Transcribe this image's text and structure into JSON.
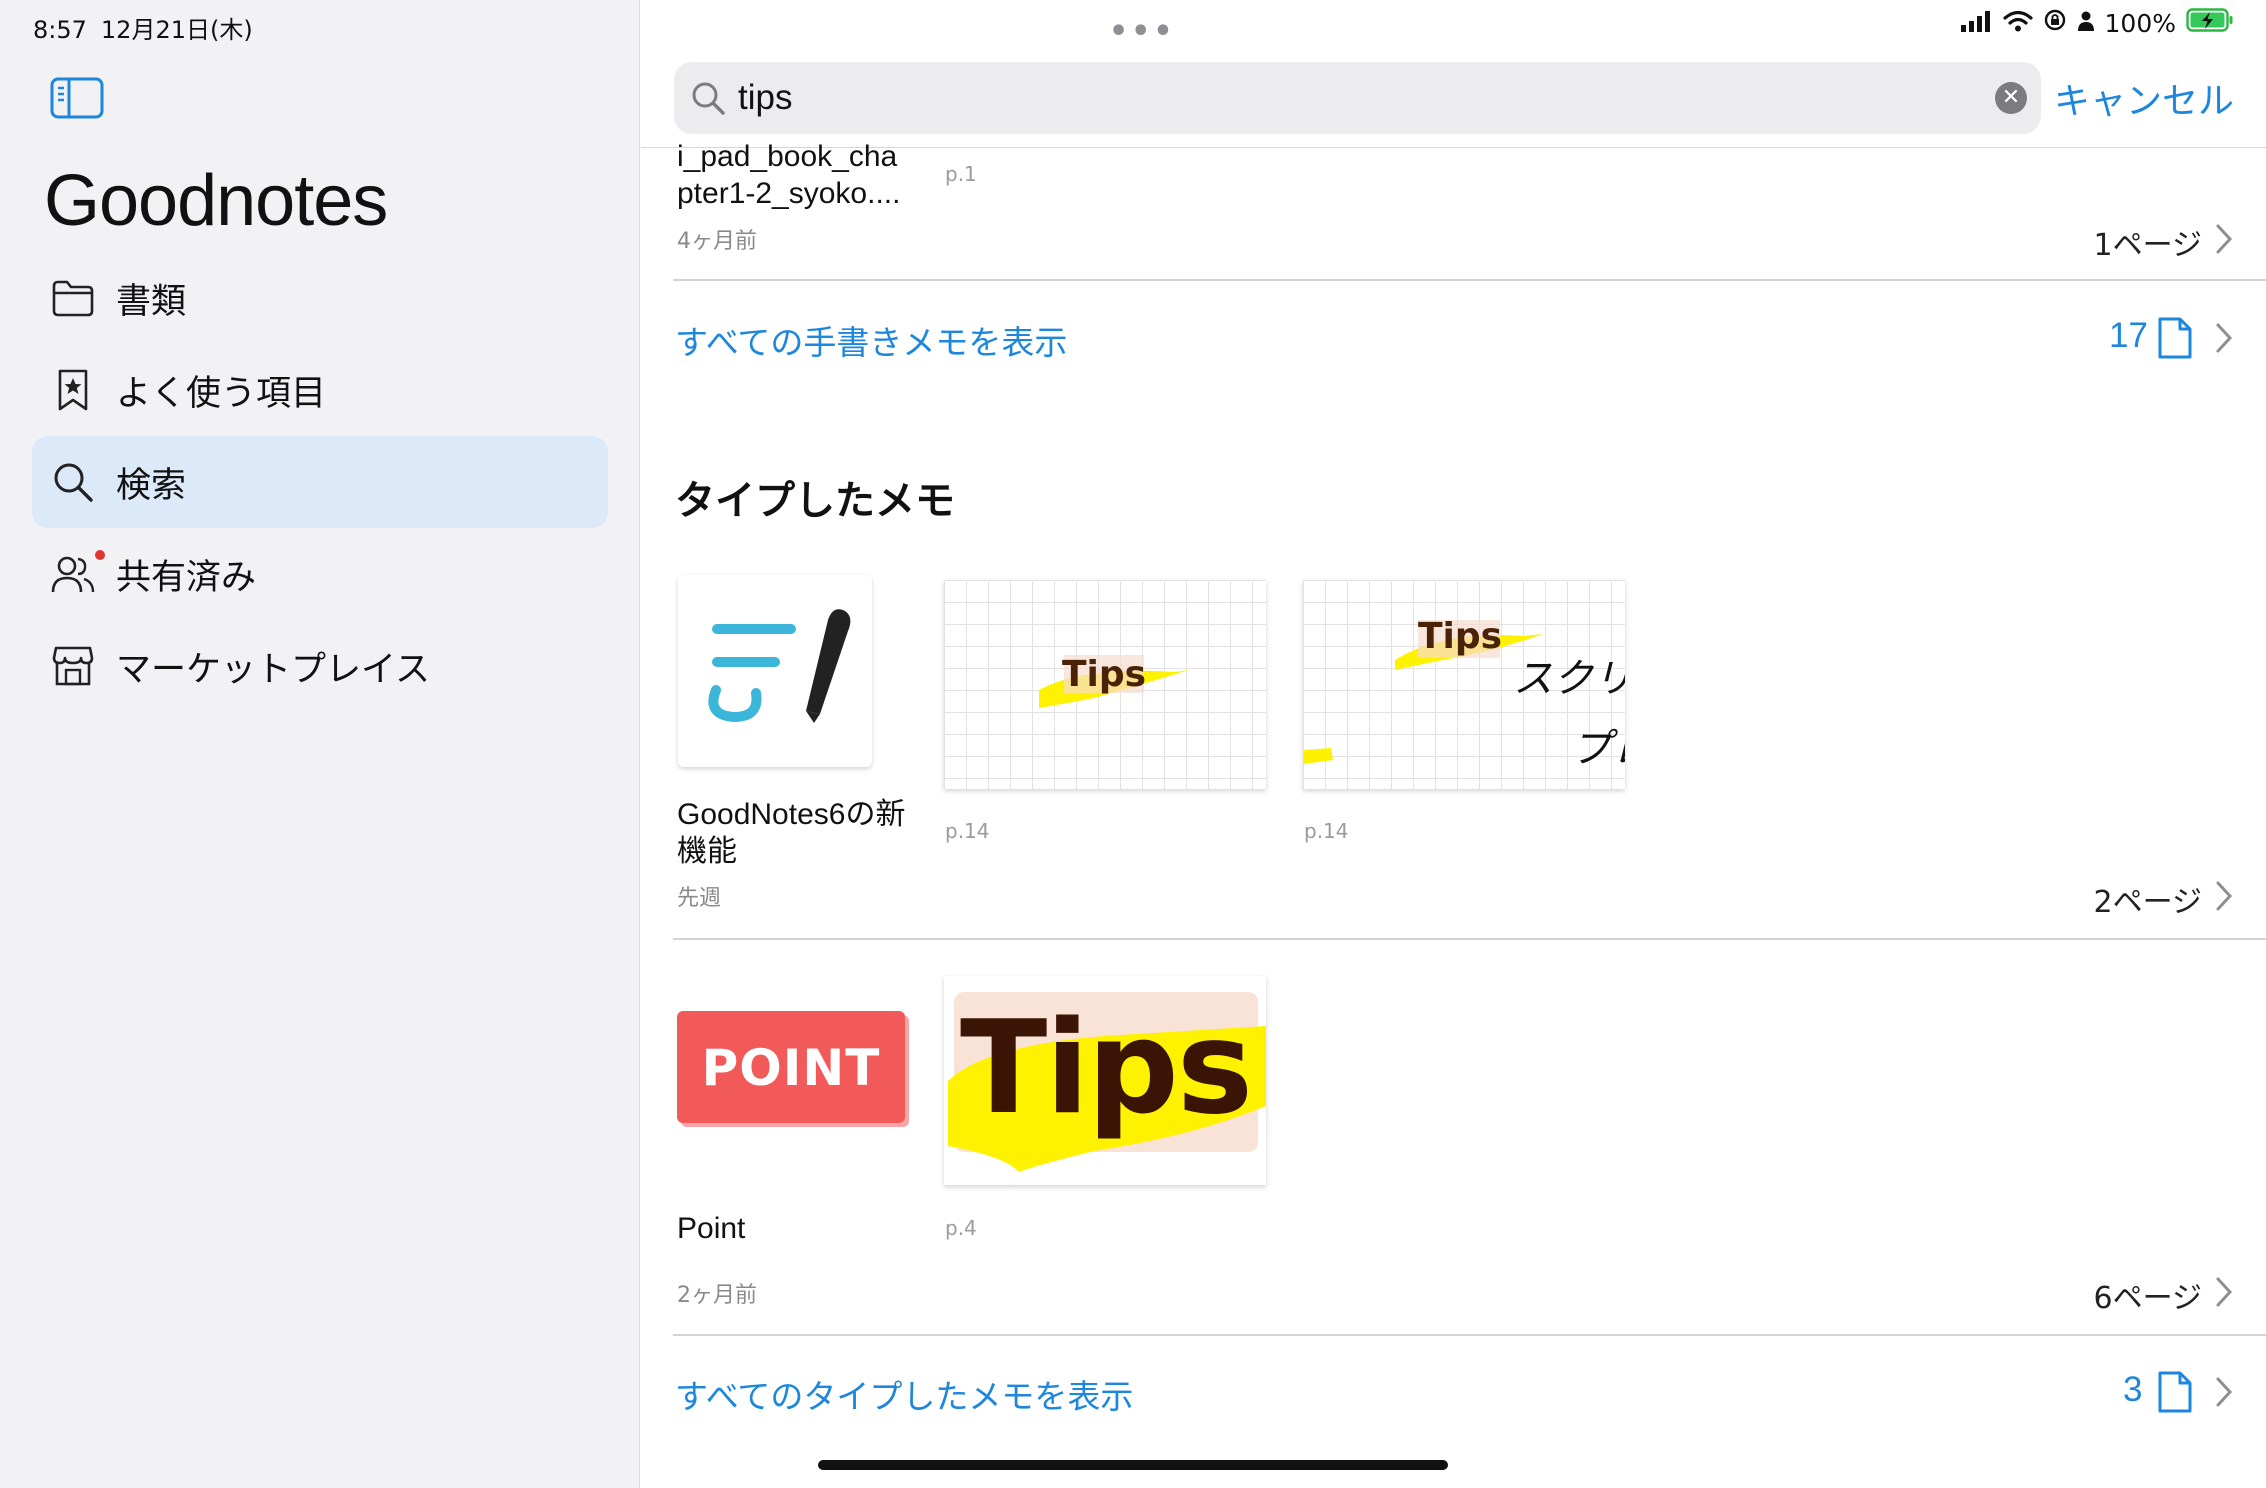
{
  "status": {
    "time": "8:57",
    "date": "12月21日(木)",
    "battery": "100%"
  },
  "sidebar": {
    "title": "Goodnotes",
    "items": [
      {
        "label": "書類",
        "icon": "folder-icon"
      },
      {
        "label": "よく使う項目",
        "icon": "bookmark-star-icon"
      },
      {
        "label": "検索",
        "icon": "search-icon",
        "active": true
      },
      {
        "label": "共有済み",
        "icon": "people-icon",
        "badge": true
      },
      {
        "label": "マーケットプレイス",
        "icon": "store-icon"
      }
    ]
  },
  "search": {
    "query": "tips",
    "placeholder": "",
    "cancel_label": "キャンセル"
  },
  "handwritten": {
    "top_item": {
      "title": "i_pad_book_chapter1-2_syoko....",
      "title_line1": "i_pad_book_cha",
      "title_line2": "pter1-2_syoko....",
      "date": "4ヶ月前",
      "page_ref": "p.1",
      "page_count": "1ページ"
    },
    "show_all_label": "すべての手書きメモを表示",
    "show_all_count": "17"
  },
  "typed": {
    "section_title": "タイプしたメモ",
    "items": [
      {
        "title_line1": "GoodNotes6の新",
        "title_line2": "機能",
        "date": "先週",
        "page_refs": [
          "p.14",
          "p.14"
        ],
        "thumb_texts": [
          "Tips",
          "Tips",
          "スクリー",
          "プレ"
        ],
        "page_count": "2ページ"
      },
      {
        "title": "Point",
        "date": "2ヶ月前",
        "cover_text": "POINT",
        "thumb_text": "Tips",
        "page_refs": [
          "p.4"
        ],
        "page_count": "6ページ"
      }
    ],
    "show_all_label": "すべてのタイプしたメモを表示",
    "show_all_count": "3"
  },
  "colors": {
    "accent": "#1d86dd",
    "sidebar_bg": "#f2f2f4",
    "active_bg": "#dce9f8",
    "highlight_yellow": "#fff200",
    "point_red": "#f25a5a",
    "gn_teal": "#3bb5d8"
  }
}
